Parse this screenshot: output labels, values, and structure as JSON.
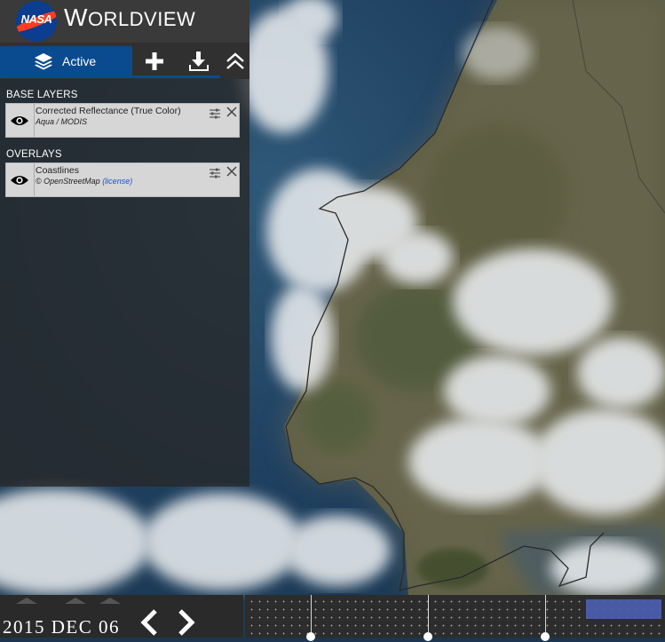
{
  "header": {
    "logo_text": "NASA",
    "title_w": "W",
    "title_rest": "ORLDVIEW"
  },
  "sidebar": {
    "tabs": [
      {
        "label": "Active",
        "icon": "layers-icon",
        "active": true
      }
    ],
    "tools": [
      "add-layers-icon",
      "download-icon",
      "collapse-icon"
    ],
    "base_layers_title": "BASE LAYERS",
    "overlays_title": "OVERLAYS",
    "base_layers": [
      {
        "name": "Corrected Reflectance (True Color)",
        "source": "Aqua / MODIS",
        "link": ""
      }
    ],
    "overlays": [
      {
        "name": "Coastlines",
        "source": "© OpenStreetMap",
        "link": "(license)"
      }
    ]
  },
  "timeline": {
    "date": "2015 DEC 06",
    "prev": "‹",
    "next": "›"
  },
  "colors": {
    "accent": "#0a4b8f",
    "panel": "#303030",
    "range": "#4b5fb1"
  }
}
